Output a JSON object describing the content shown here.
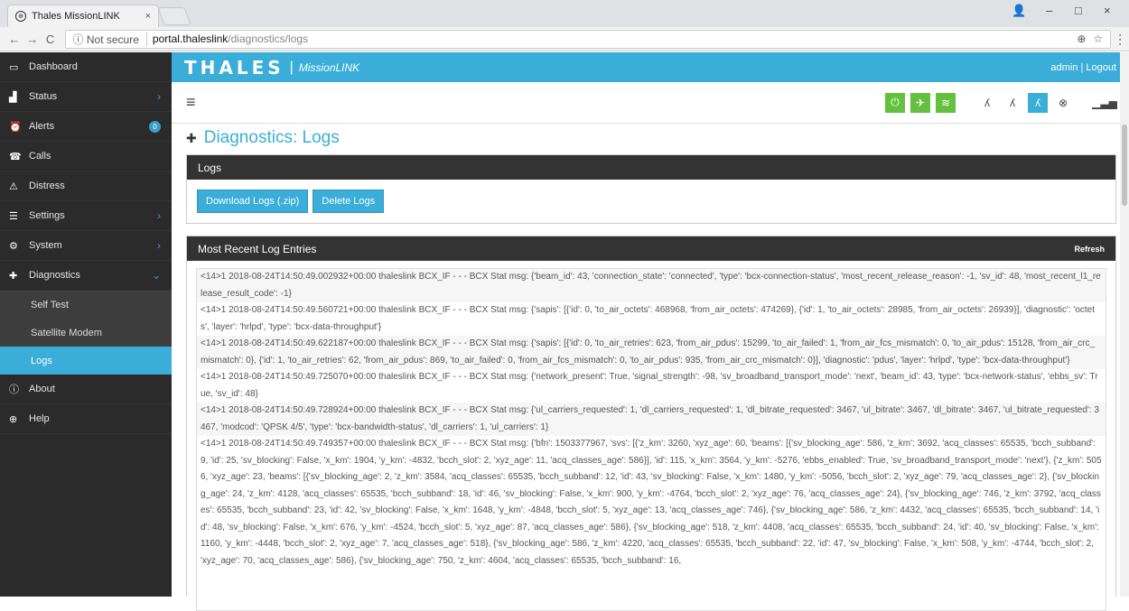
{
  "browser": {
    "tab_title": "Thales MissionLINK",
    "url_security": "Not secure",
    "url_host": "portal.thaleslink",
    "url_path": "/diagnostics/logs"
  },
  "sidebar": {
    "items": [
      {
        "label": "Dashboard",
        "icon": "monitor-icon"
      },
      {
        "label": "Status",
        "icon": "bar-chart-icon",
        "chevron": ">"
      },
      {
        "label": "Alerts",
        "icon": "alarm-icon",
        "badge": "0"
      },
      {
        "label": "Calls",
        "icon": "phone-icon"
      },
      {
        "label": "Distress",
        "icon": "warning-icon"
      },
      {
        "label": "Settings",
        "icon": "sliders-icon",
        "chevron": ">"
      },
      {
        "label": "System",
        "icon": "gear-icon",
        "chevron": ">"
      },
      {
        "label": "Diagnostics",
        "icon": "medkit-icon",
        "chevron": "v"
      }
    ],
    "sub_items": [
      {
        "label": "Self Test"
      },
      {
        "label": "Satellite Modem"
      },
      {
        "label": "Logs",
        "active": true
      }
    ],
    "bottom_items": [
      {
        "label": "About",
        "icon": "info-icon"
      },
      {
        "label": "Help",
        "icon": "lifebuoy-icon"
      }
    ]
  },
  "header": {
    "brand": "THALES",
    "separator": "|",
    "product": "MissionLINK",
    "user": "admin | Logout"
  },
  "page": {
    "title": "Diagnostics: Logs"
  },
  "logs_panel": {
    "title": "Logs",
    "download_label": "Download Logs (.zip)",
    "delete_label": "Delete Logs"
  },
  "recent_panel": {
    "title": "Most Recent Log Entries",
    "refresh_label": "Refresh"
  },
  "log_entries": [
    "<14>1 2018-08-24T14:50:49.002932+00:00 thaleslink BCX_IF - - - BCX Stat msg: {'beam_id': 43, 'connection_state': 'connected', 'type': 'bcx-connection-status', 'most_recent_release_reason': -1, 'sv_id': 48, 'most_recent_l1_release_result_code': -1}",
    "<14>1 2018-08-24T14:50:49.560721+00:00 thaleslink BCX_IF - - - BCX Stat msg: {'sapis': [{'id': 0, 'to_air_octets': 468968, 'from_air_octets': 474269}, {'id': 1, 'to_air_octets': 28985, 'from_air_octets': 26939}], 'diagnostic': 'octets', 'layer': 'hrlpd', 'type': 'bcx-data-throughput'}",
    "<14>1 2018-08-24T14:50:49.622187+00:00 thaleslink BCX_IF - - - BCX Stat msg: {'sapis': [{'id': 0, 'to_air_retries': 623, 'from_air_pdus': 15299, 'to_air_failed': 1, 'from_air_fcs_mismatch': 0, 'to_air_pdus': 15128, 'from_air_crc_mismatch': 0}, {'id': 1, 'to_air_retries': 62, 'from_air_pdus': 869, 'to_air_failed': 0, 'from_air_fcs_mismatch': 0, 'to_air_pdus': 935, 'from_air_crc_mismatch': 0}], 'diagnostic': 'pdus', 'layer': 'hrlpd', 'type': 'bcx-data-throughput'}",
    "<14>1 2018-08-24T14:50:49.725070+00:00 thaleslink BCX_IF - - - BCX Stat msg: {'network_present': True, 'signal_strength': -98, 'sv_broadband_transport_mode': 'next', 'beam_id': 43, 'type': 'bcx-network-status', 'ebbs_sv': True, 'sv_id': 48}",
    "<14>1 2018-08-24T14:50:49.728924+00:00 thaleslink BCX_IF - - - BCX Stat msg: {'ul_carriers_requested': 1, 'dl_carriers_requested': 1, 'dl_bitrate_requested': 3467, 'ul_bitrate': 3467, 'dl_bitrate': 3467, 'ul_bitrate_requested': 3467, 'modcod': 'QPSK 4/5', 'type': 'bcx-bandwidth-status', 'dl_carriers': 1, 'ul_carriers': 1}",
    "<14>1 2018-08-24T14:50:49.749357+00:00 thaleslink BCX_IF - - - BCX Stat msg: {'bfn': 1503377967, 'svs': [{'z_km': 3260, 'xyz_age': 60, 'beams': [{'sv_blocking_age': 586, 'z_km': 3692, 'acq_classes': 65535, 'bcch_subband': 9, 'id': 25, 'sv_blocking': False, 'x_km': 1904, 'y_km': -4832, 'bcch_slot': 2, 'xyz_age': 11, 'acq_classes_age': 586}], 'id': 115, 'x_km': 3564, 'y_km': -5276, 'ebbs_enabled': True, 'sv_broadband_transport_mode': 'next'}, {'z_km': 5056, 'xyz_age': 23, 'beams': [{'sv_blocking_age': 2, 'z_km': 3584, 'acq_classes': 65535, 'bcch_subband': 12, 'id': 43, 'sv_blocking': False, 'x_km': 1480, 'y_km': -5056, 'bcch_slot': 2, 'xyz_age': 79, 'acq_classes_age': 2}, {'sv_blocking_age': 24, 'z_km': 4128, 'acq_classes': 65535, 'bcch_subband': 18, 'id': 46, 'sv_blocking': False, 'x_km': 900, 'y_km': -4764, 'bcch_slot': 2, 'xyz_age': 76, 'acq_classes_age': 24}, {'sv_blocking_age': 746, 'z_km': 3792, 'acq_classes': 65535, 'bcch_subband': 23, 'id': 42, 'sv_blocking': False, 'x_km': 1648, 'y_km': -4848, 'bcch_slot': 5, 'xyz_age': 13, 'acq_classes_age': 746}, {'sv_blocking_age': 586, 'z_km': 4432, 'acq_classes': 65535, 'bcch_subband': 14, 'id': 48, 'sv_blocking': False, 'x_km': 676, 'y_km': -4524, 'bcch_slot': 5, 'xyz_age': 87, 'acq_classes_age': 586}, {'sv_blocking_age': 518, 'z_km': 4408, 'acq_classes': 65535, 'bcch_subband': 24, 'id': 40, 'sv_blocking': False, 'x_km': 1160, 'y_km': -4448, 'bcch_slot': 2, 'xyz_age': 7, 'acq_classes_age': 518}, {'sv_blocking_age': 586, 'z_km': 4220, 'acq_classes': 65535, 'bcch_subband': 22, 'id': 47, 'sv_blocking': False, 'x_km': 508, 'y_km': -4744, 'bcch_slot': 2, 'xyz_age': 70, 'acq_classes_age': 586}, {'sv_blocking_age': 750, 'z_km': 4604, 'acq_classes': 65535, 'bcch_subband': 16,"
  ],
  "colors": {
    "accent": "#3aaed8",
    "sidebar_bg": "#2b2b2b",
    "status_green": "#64c13f"
  }
}
